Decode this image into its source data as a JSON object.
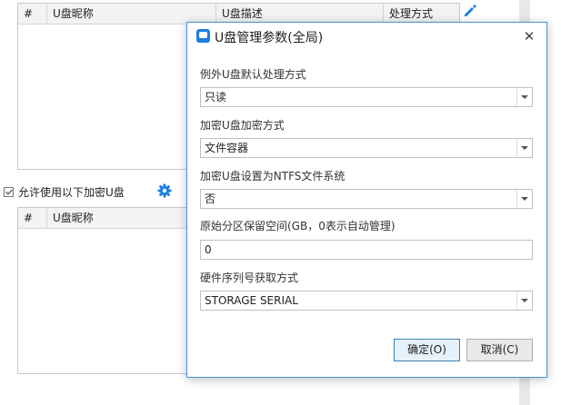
{
  "top_table": {
    "columns": [
      "#",
      "U盘昵称",
      "U盘描述",
      "处理方式"
    ],
    "edit_icon": "pencil-icon"
  },
  "allow_checkbox": {
    "label": "允许使用以下加密U盘",
    "checked": true,
    "settings_icon": "gear-icon"
  },
  "bottom_table": {
    "columns": [
      "#",
      "U盘昵称"
    ]
  },
  "dialog": {
    "title": "U盘管理参数(全局)",
    "close_symbol": "✕",
    "fields": [
      {
        "label": "例外U盘默认处理方式",
        "value": "只读",
        "type": "select"
      },
      {
        "label": "加密U盘加密方式",
        "value": "文件容器",
        "type": "select"
      },
      {
        "label": "加密U盘设置为NTFS文件系统",
        "value": "否",
        "type": "select"
      },
      {
        "label": "原始分区保留空间(GB，0表示自动管理)",
        "value": "0",
        "type": "text"
      },
      {
        "label": "硬件序列号获取方式",
        "value": "STORAGE SERIAL",
        "type": "select"
      }
    ],
    "ok_label": "确定(O)",
    "cancel_label": "取消(C)"
  },
  "colors": {
    "accent": "#1c7fe0",
    "dialog_border": "#4a90d9"
  }
}
